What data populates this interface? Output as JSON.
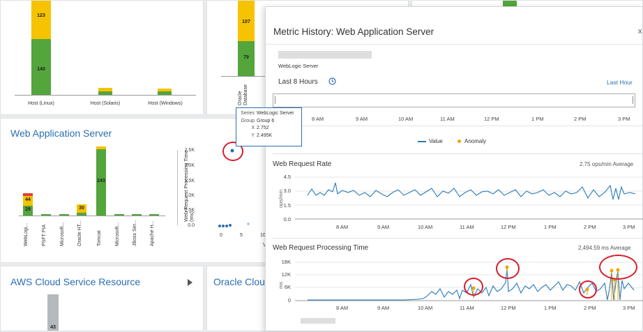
{
  "host_tile": {
    "bars": [
      {
        "label": "Host (Linux)",
        "green": 140,
        "yellow": 123
      },
      {
        "label": "Host (Solaris)",
        "green": null,
        "yellow": null
      },
      {
        "label": "Host (Windows)",
        "green": null,
        "yellow": null
      }
    ]
  },
  "db_tile": {
    "values": {
      "top": "107",
      "bottom": "79"
    },
    "category": "Oracle Database"
  },
  "was_tile": {
    "title": "Web Application Server",
    "bars": [
      {
        "label": "WebLogi...",
        "green": "29",
        "yellow": "44"
      },
      {
        "label": "PSFT PIA"
      },
      {
        "label": "Microsoft..."
      },
      {
        "label": "Oracle HT...",
        "yellow": "30"
      },
      {
        "label": "Tomcat",
        "green": "243"
      },
      {
        "label": "Microsoft..."
      },
      {
        "label": "JBoss Ser..."
      },
      {
        "label": "Apache H..."
      }
    ],
    "scatter": {
      "ylabel": "Web Request Processing Time (ms)",
      "yticks": [
        "2.5K",
        "2.0K",
        "1.5K",
        "1.0K",
        "0.5K",
        "0.0"
      ],
      "xticks": [
        "0",
        "5",
        "10"
      ],
      "xlabel_partial": "V"
    }
  },
  "tooltip": {
    "series_key": "Series",
    "series_val": "WebLogic Server",
    "group_key": "Group",
    "group_val": "Group 6",
    "x_key": "X",
    "x_val": "2.752",
    "y_key": "Y",
    "y_val": "2.495K"
  },
  "aws_tile": {
    "title": "AWS Cloud Service Resource",
    "value": "43"
  },
  "oracle_cloud_tile": {
    "title": "Oracle Cloud"
  },
  "panel": {
    "title": "Metric History: Web Application Server",
    "close": "x",
    "entity_type": "WebLogic Server",
    "time_range": "Last 8 Hours",
    "last_hour": "Last Hour",
    "time_axis": [
      "8 AM",
      "9 AM",
      "10 AM",
      "11 AM",
      "12 PM",
      "1 PM",
      "2 PM",
      "3 PM"
    ],
    "legend": {
      "value": "Value",
      "anomaly": "Anomaly"
    },
    "colors": {
      "line": "#2a7ab8",
      "anomaly": "#f0a500"
    },
    "rate_chart": {
      "title": "Web Request Rate",
      "summary": "2.75 ops/min",
      "summary_suffix": "Average",
      "ylabel": "ops/min",
      "yticks": [
        "4.5",
        "3.0",
        "1.5",
        "0.0"
      ]
    },
    "time_chart": {
      "title": "Web Request Processing Time",
      "summary": "2,494.59 ms",
      "summary_suffix": "Average",
      "ylabel": "ms",
      "yticks": [
        "18K",
        "12K",
        "6K",
        "0"
      ]
    }
  },
  "chart_data": [
    {
      "type": "bar",
      "categories": [
        "WebLogi...",
        "PSFT PIA",
        "Microsoft...",
        "Oracle HT...",
        "Tomcat",
        "Microsoft...",
        "JBoss Ser...",
        "Apache H..."
      ],
      "series": [
        {
          "name": "green",
          "values": [
            29,
            2,
            2,
            12,
            243,
            2,
            2,
            2
          ]
        },
        {
          "name": "yellow",
          "values": [
            44,
            0,
            0,
            30,
            8,
            0,
            0,
            0
          ]
        },
        {
          "name": "red",
          "values": [
            6,
            0,
            0,
            0,
            0,
            0,
            0,
            0
          ]
        }
      ]
    },
    {
      "type": "scatter",
      "ylabel": "Web Request Processing Time (ms)",
      "ylim": [
        0,
        2500
      ],
      "series": [
        {
          "name": "WebLogic Server",
          "x": [
            2.752,
            0.5,
            1.0,
            1.5,
            2.5,
            7.5
          ],
          "y": [
            2495,
            10,
            10,
            10,
            20,
            60
          ]
        }
      ]
    },
    {
      "type": "line",
      "title": "Web Request Rate",
      "ylabel": "ops/min",
      "ylim": [
        0,
        4.5
      ]
    },
    {
      "type": "line",
      "title": "Web Request Processing Time",
      "ylabel": "ms",
      "ylim": [
        0,
        18000
      ]
    }
  ]
}
